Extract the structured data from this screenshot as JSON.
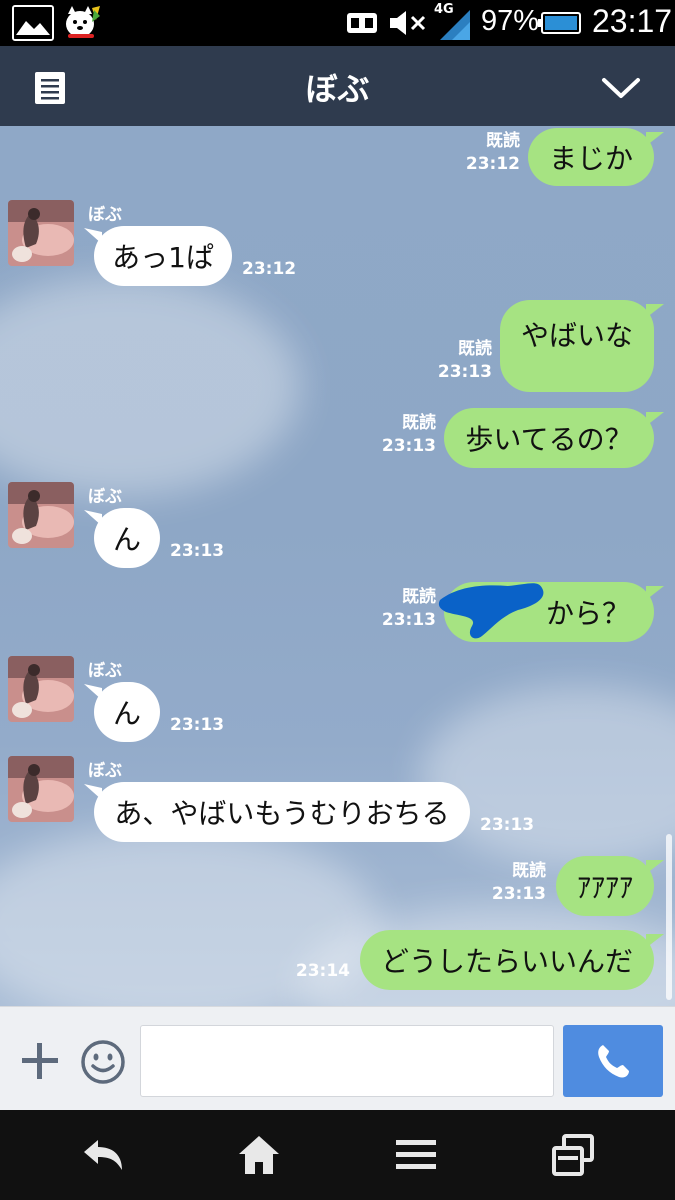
{
  "status_bar": {
    "battery_percent": "97%",
    "time": "23:17",
    "network": "4G",
    "icons": [
      "gallery-icon",
      "dog-icon",
      "sim-icon",
      "mute-icon",
      "signal-icon",
      "battery-icon"
    ]
  },
  "header": {
    "title": "ぼぶ",
    "icons": [
      "menu-icon",
      "chevron-down-icon"
    ]
  },
  "messages": [
    {
      "dir": "out",
      "text": "まじか",
      "read": "既読",
      "time": "23:12"
    },
    {
      "dir": "in",
      "sender": "ぼぶ",
      "text": "あっ1ぱ",
      "time": "23:12"
    },
    {
      "dir": "out",
      "text": "やばいな",
      "read": "既読",
      "time": "23:13"
    },
    {
      "dir": "out",
      "text": "歩いてるの？",
      "read": "既読",
      "time": "23:13"
    },
    {
      "dir": "in",
      "sender": "ぼぶ",
      "text": "ん",
      "time": "23:13"
    },
    {
      "dir": "out",
      "text": "から？",
      "read": "既読",
      "time": "23:13"
    },
    {
      "dir": "in",
      "sender": "ぼぶ",
      "text": "ん",
      "time": "23:13"
    },
    {
      "dir": "in",
      "sender": "ぼぶ",
      "text": "あ、やばいもうむりおちる",
      "time": "23:13"
    },
    {
      "dir": "out",
      "text": "ｱｱｱｱ",
      "read": "既読",
      "time": "23:13"
    },
    {
      "dir": "out",
      "text": "どうしたらいいんだ",
      "time": "23:14"
    }
  ],
  "input_bar": {
    "placeholder": "",
    "icons": [
      "plus-icon",
      "emoji-icon",
      "phone-icon"
    ]
  },
  "nav_bar": {
    "icons": [
      "back-icon",
      "home-icon",
      "menu-lines-icon",
      "recent-apps-icon"
    ]
  },
  "colors": {
    "header_bg": "#2f3b4e",
    "chat_bg": "#8fa8c7",
    "outgoing_bubble": "#a6e382",
    "incoming_bubble": "#ffffff",
    "call_button": "#4f8ce0",
    "scribble": "#0a62c8"
  }
}
